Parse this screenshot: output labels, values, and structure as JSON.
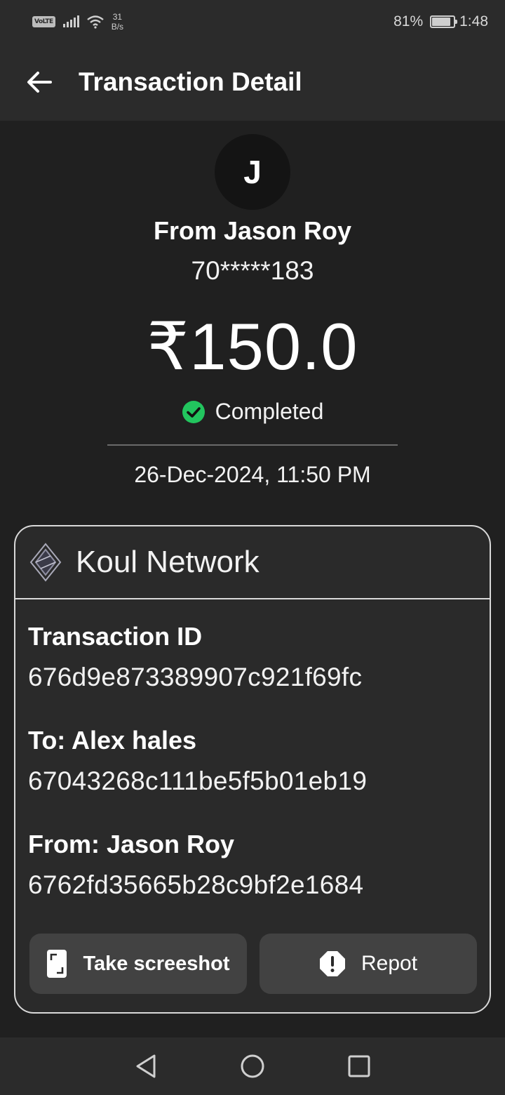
{
  "status_bar": {
    "volte": "VoLTE",
    "speed_value": "31",
    "speed_unit": "B/s",
    "battery": "81%",
    "battery_level": 0.81,
    "time": "1:48"
  },
  "app_bar": {
    "title": "Transaction Detail",
    "back_icon": "arrow-left-icon"
  },
  "hero": {
    "avatar_initial": "J",
    "from_line": "From Jason Roy",
    "phone_masked": "70*****183",
    "amount": "₹150.0",
    "status": "Completed",
    "status_color": "#22c55e",
    "datetime": "26-Dec-2024, 11:50 PM"
  },
  "card": {
    "network_logo": "diamond-logo-icon",
    "network_name": "Koul Network",
    "fields": [
      {
        "label": "Transaction ID",
        "value": "676d9e873389907c921f69fc"
      },
      {
        "label": "To: Alex hales",
        "value": "67043268c111be5f5b01eb19"
      },
      {
        "label": "From: Jason Roy",
        "value": "6762fd35665b28c9bf2e1684"
      }
    ],
    "screenshot_button": "Take screeshot",
    "report_button": "Repot"
  },
  "nav": {
    "back": "nav-back-icon",
    "home": "nav-home-icon",
    "recents": "nav-recents-icon"
  }
}
